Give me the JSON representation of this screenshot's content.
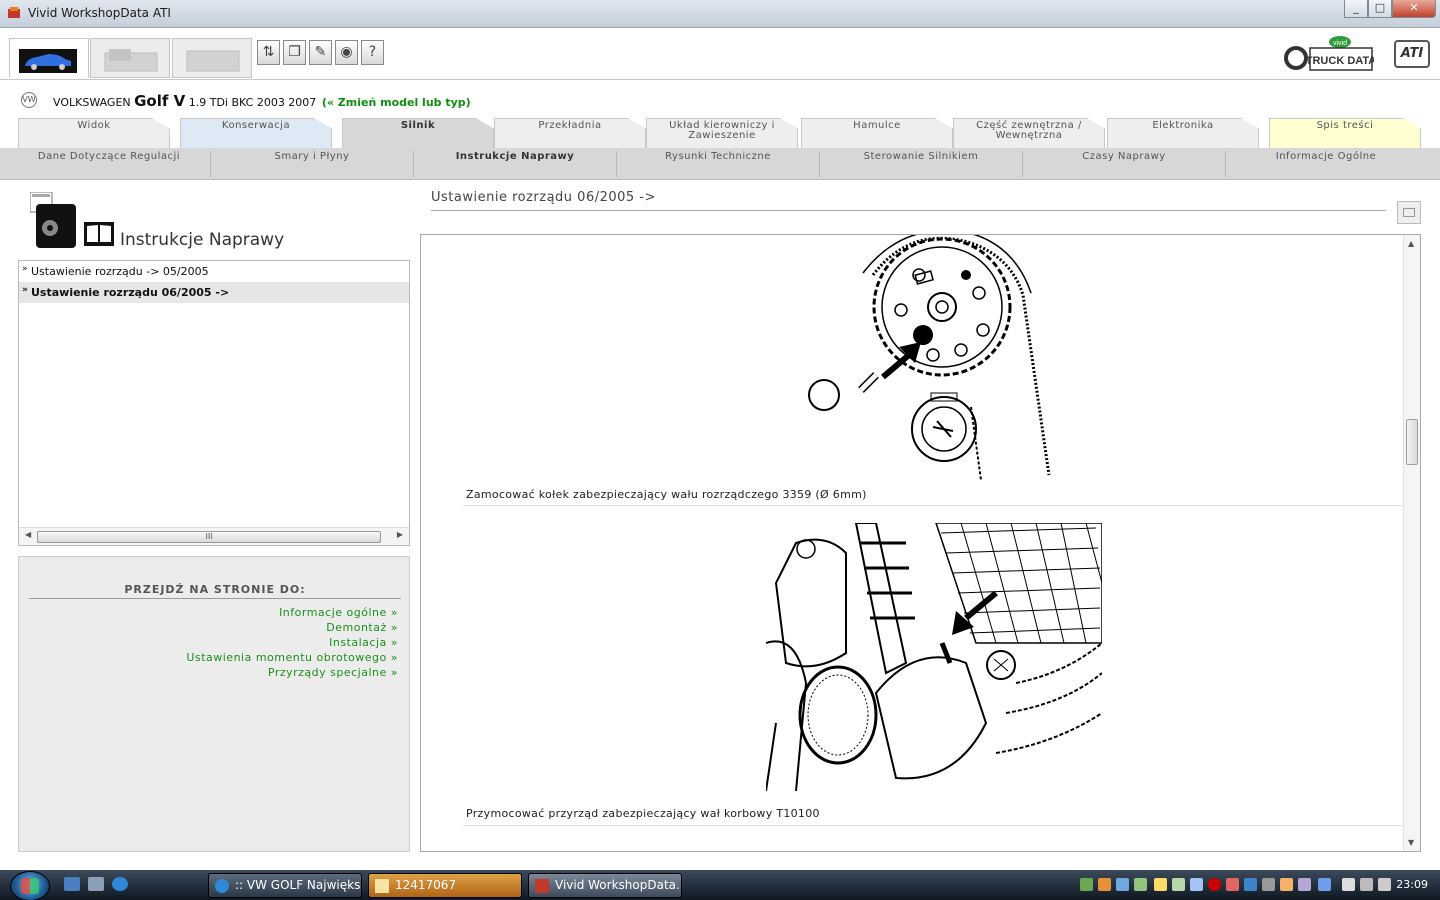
{
  "window": {
    "title": "Vivid WorkshopData ATI",
    "buttons": [
      "_",
      "□",
      "✕"
    ]
  },
  "toolbar": {
    "tool_icons": [
      "tree-icon",
      "copy-icon",
      "edit-icon",
      "cd-icon",
      "help-icon"
    ],
    "tool_glyphs": [
      "⇅",
      "❐",
      "✎",
      "◉",
      "?"
    ],
    "brand_top": "vivid",
    "brand_main": "TRUCK DATA",
    "brand_small": "ATI"
  },
  "vehicle": {
    "make": "VOLKSWAGEN",
    "model": "Golf V",
    "engine": "1.9 TDi BKC 2003 2007",
    "change_link": "(« Zmień model lub typ)",
    "logo_text": "VW"
  },
  "main_tabs": [
    {
      "label": "Widok"
    },
    {
      "label": "Konserwacja"
    },
    {
      "label": "Silnik"
    },
    {
      "label": "Przekładnia"
    },
    {
      "label": "Układ kierowniczy i Zawieszenie"
    },
    {
      "label": "Hamulce"
    },
    {
      "label": "Część zewnętrzna / Wewnętrzna"
    },
    {
      "label": "Elektronika"
    },
    {
      "label": "Spis treści"
    }
  ],
  "sub_tabs": [
    {
      "label": "Dane Dotyczące Regulacji"
    },
    {
      "label": "Smary i Płyny"
    },
    {
      "label": "Instrukcje Naprawy"
    },
    {
      "label": "Rysunki Techniczne"
    },
    {
      "label": "Sterowanie Silnikiem"
    },
    {
      "label": "Czasy Naprawy"
    },
    {
      "label": "Informacje Ogólne"
    }
  ],
  "left_panel": {
    "title": "Instrukcje Naprawy",
    "documents": [
      {
        "label": "Ustawienie rozrządu -> 05/2005",
        "selected": false
      },
      {
        "label": "Ustawienie rozrządu 06/2005 ->",
        "selected": true
      }
    ],
    "scroll_grip": "III"
  },
  "goto": {
    "title": "PRZEJDŹ NA STRONIE DO:",
    "links": [
      "Informacje ogólne »",
      "Demontaż »",
      "Instalacja »",
      "Ustawienia momentu obrotowego »",
      "Przyrządy specjalne »"
    ]
  },
  "content": {
    "title": "Ustawienie rozrządu 06/2005 ->",
    "steps": [
      {
        "caption": "Zamocować kołek zabezpieczający wału rozrządczego 3359 (Ø 6mm)"
      },
      {
        "caption": "Przymocować przyrząd zabezpieczający wał korbowy T10100"
      }
    ]
  },
  "taskbar": {
    "tasks": [
      {
        "label": ":: VW GOLF Największ..."
      },
      {
        "label": "12417067"
      },
      {
        "label": "Vivid WorkshopData..."
      }
    ],
    "clock": "23:09"
  },
  "colors": {
    "link_green": "#1a8f1a",
    "change_link_green": "#0f8f0f",
    "tab_blue": "#dde9f5",
    "tab_yellow": "#ffffd2"
  }
}
